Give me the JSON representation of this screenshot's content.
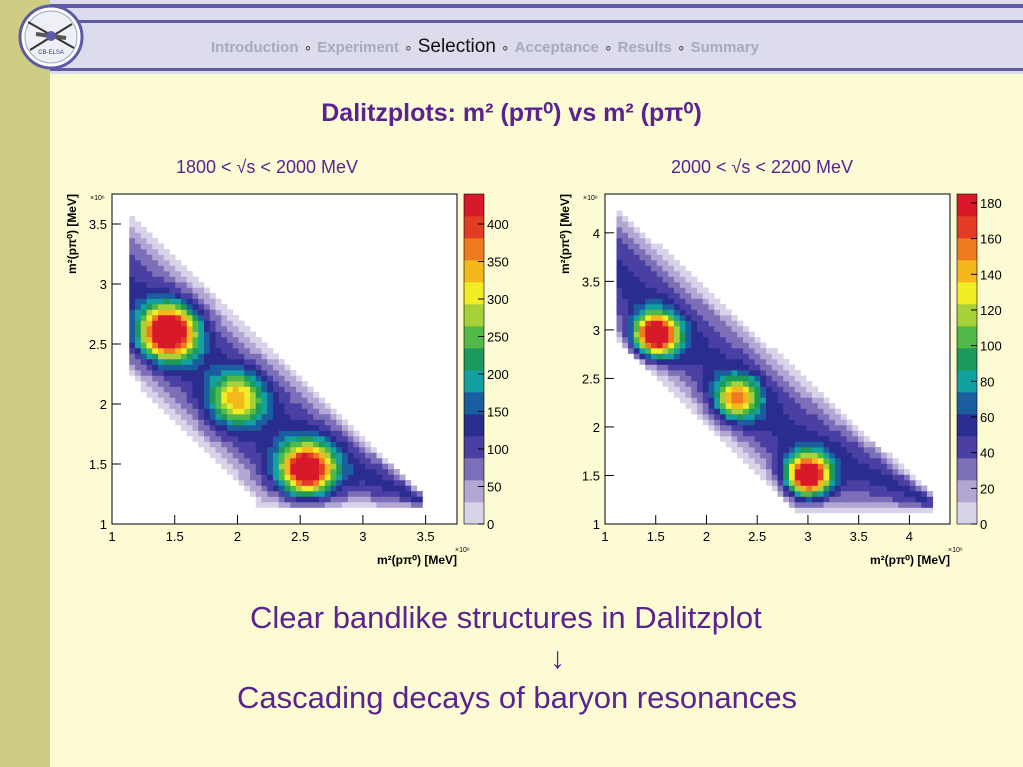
{
  "header": {
    "logo_text": "CB-ELSA",
    "nav": [
      {
        "label": "Introduction",
        "active": false
      },
      {
        "label": "Experiment",
        "active": false
      },
      {
        "label": "Selection",
        "active": true
      },
      {
        "label": "Acceptance",
        "active": false
      },
      {
        "label": "Results",
        "active": false
      },
      {
        "label": "Summary",
        "active": false
      }
    ],
    "separator": "∘"
  },
  "slide": {
    "title": "Dalitzplots: m² (pπ⁰)  vs  m² (pπ⁰)",
    "conclusion_line1": "Clear bandlike structures in Dalitzplot",
    "arrow": "↓",
    "conclusion_line2": "Cascading decays of baryon resonances"
  },
  "colors": {
    "accent": "#5a2391",
    "background": "#fcfbd3",
    "palette": [
      "#d8d3e8",
      "#b3a6d3",
      "#7d6eb8",
      "#4a3fa3",
      "#2b2c8f",
      "#1b5ea0",
      "#12a0a0",
      "#1c9a5c",
      "#50b948",
      "#a7d138",
      "#f1ec24",
      "#f5b81c",
      "#f07a1f",
      "#e23c24",
      "#d8192a"
    ]
  },
  "chart_data": [
    {
      "type": "heatmap",
      "title": "1800 < √s < 2000 MeV",
      "xlabel": "m²(pπ⁰) [MeV]",
      "ylabel": "m²(pπ⁰) [MeV]",
      "exp_label": "×10⁶",
      "xlim": [
        1,
        3.75
      ],
      "ylim": [
        1,
        3.75
      ],
      "xticks": [
        1,
        1.5,
        2,
        2.5,
        3,
        3.5
      ],
      "yticks": [
        1,
        1.5,
        2,
        2.5,
        3,
        3.5
      ],
      "zmax": 440,
      "colorbar_ticks": [
        0,
        50,
        100,
        150,
        200,
        250,
        300,
        350,
        400
      ],
      "band": {
        "x_low": 1.13,
        "x_high": 3.48,
        "y_low_start": 2.25,
        "y_high_start": 3.6,
        "slope": -1.0
      },
      "peaks": [
        {
          "x": 1.45,
          "y": 2.6,
          "value": 430
        },
        {
          "x": 2.55,
          "y": 1.45,
          "value": 410
        },
        {
          "x": 2.0,
          "y": 2.05,
          "value": 230
        }
      ]
    },
    {
      "type": "heatmap",
      "title": "2000 < √s < 2200 MeV",
      "xlabel": "m²(pπ⁰) [MeV]",
      "ylabel": "m²(pπ⁰) [MeV]",
      "exp_label": "×10⁶",
      "xlim": [
        1,
        4.4
      ],
      "ylim": [
        1,
        4.4
      ],
      "xticks": [
        1,
        1.5,
        2,
        2.5,
        3,
        3.5,
        4
      ],
      "yticks": [
        1,
        1.5,
        2,
        2.5,
        3,
        3.5,
        4
      ],
      "zmax": 185,
      "colorbar_ticks": [
        0,
        20,
        40,
        60,
        80,
        100,
        120,
        140,
        160,
        180
      ],
      "band": {
        "x_low": 1.13,
        "x_high": 4.25,
        "y_low_start": 2.9,
        "y_high_start": 4.25,
        "slope": -0.95
      },
      "peaks": [
        {
          "x": 1.5,
          "y": 2.95,
          "value": 180
        },
        {
          "x": 3.0,
          "y": 1.5,
          "value": 175
        },
        {
          "x": 2.3,
          "y": 2.3,
          "value": 110
        }
      ]
    }
  ]
}
